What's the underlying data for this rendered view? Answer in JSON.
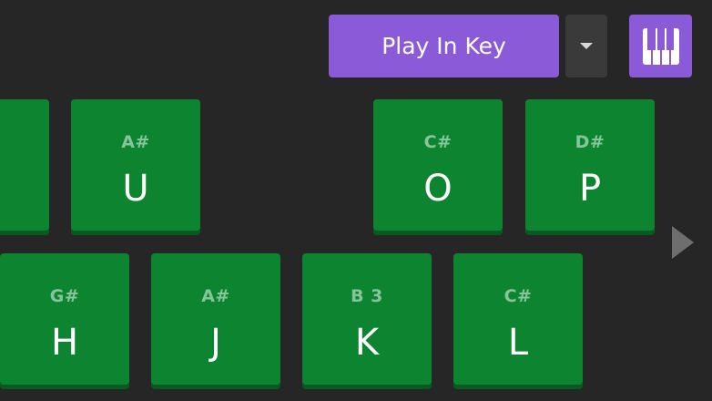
{
  "toolbar": {
    "play_label": "Play In Key",
    "play_color": "#8a5ad8",
    "dropdown_icon": "caret-down-icon",
    "piano_icon": "piano-keys-icon"
  },
  "keys": {
    "row1": [
      {
        "note": "",
        "letter": ""
      },
      {
        "note": "A#",
        "letter": "U"
      },
      {
        "note": "C#",
        "letter": "O"
      },
      {
        "note": "D#",
        "letter": "P"
      }
    ],
    "row2": [
      {
        "note": "G#",
        "letter": "H"
      },
      {
        "note": "A#",
        "letter": "J"
      },
      {
        "note": "B 3",
        "letter": "K"
      },
      {
        "note": "C#",
        "letter": "L"
      }
    ]
  },
  "colors": {
    "background": "#262626",
    "key_green": "#0d8530",
    "accent_purple": "#8a5ad8"
  },
  "nav": {
    "next_icon": "chevron-right-icon"
  }
}
